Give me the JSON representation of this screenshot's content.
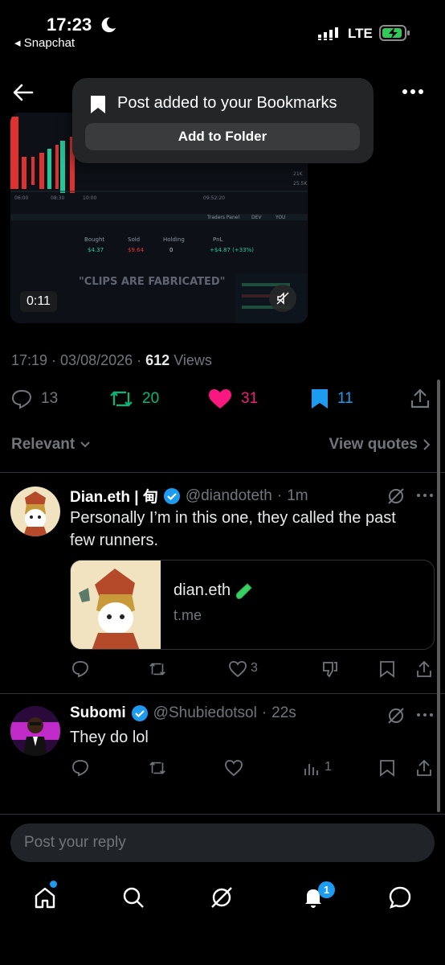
{
  "status_bar": {
    "time": "17:23",
    "back_app": "◂ Snapchat",
    "network": "LTE"
  },
  "toast": {
    "message": "Post added to your Bookmarks",
    "action": "Add to Folder"
  },
  "video": {
    "duration": "0:11",
    "overlay_text": "\"CLIPS ARE FABRICATED\"",
    "chart_labels": [
      "Bought",
      "Sold",
      "Holding",
      "PnL"
    ],
    "chart_values": [
      "$4.37",
      "$9.64",
      "0",
      "+$4.87 (+33%)"
    ]
  },
  "post": {
    "time": "17:19",
    "date": "03/08/2026",
    "views_count": "612",
    "views_label": "Views",
    "replies": "13",
    "reposts": "20",
    "likes": "31",
    "bookmarks": "11"
  },
  "filter": {
    "label": "Relevant",
    "view_quotes": "View quotes"
  },
  "replies": [
    {
      "name": "Dian.eth | 甸",
      "handle": "@diandoteth",
      "time": "1m",
      "text": "Personally I’m in this one, they called the past few runners.",
      "card": {
        "title": "dian.eth",
        "domain": "t.me"
      },
      "likes": "3"
    },
    {
      "name": "Subomi",
      "handle": "@Shubiedotsol",
      "time": "22s",
      "text": "They do lol",
      "views": "1"
    }
  ],
  "compose": {
    "placeholder": "Post your reply"
  },
  "tabbar": {
    "notifications_badge": "1"
  },
  "colors": {
    "accent": "#1d9bf0",
    "repost": "#00ba7c",
    "like": "#f91880",
    "muted": "#71767b"
  }
}
